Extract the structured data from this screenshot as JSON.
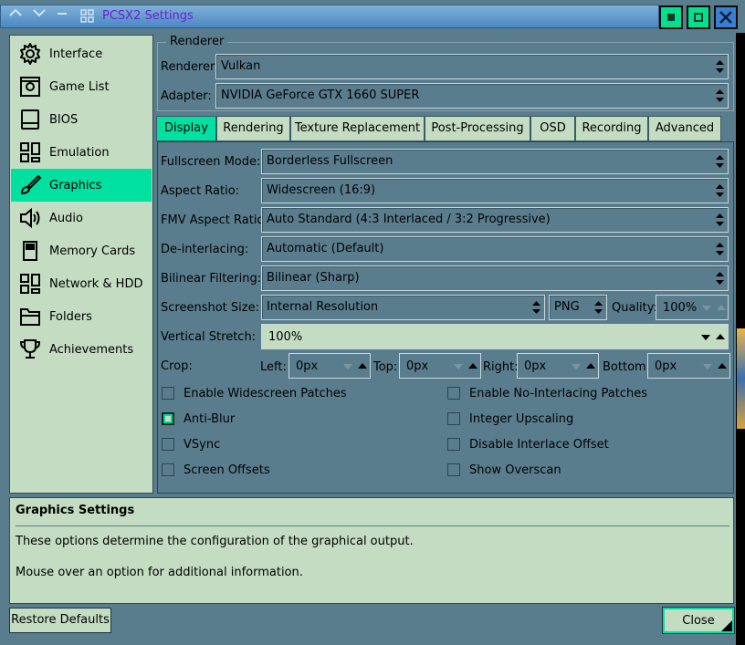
{
  "window": {
    "title": "PCSX2 Settings"
  },
  "sidebar": {
    "items": [
      {
        "label": "Interface",
        "icon": "gear-icon"
      },
      {
        "label": "Game List",
        "icon": "game-list-icon"
      },
      {
        "label": "BIOS",
        "icon": "bios-chip-icon"
      },
      {
        "label": "Emulation",
        "icon": "emulation-grid-icon"
      },
      {
        "label": "Graphics",
        "icon": "brush-icon",
        "selected": true
      },
      {
        "label": "Audio",
        "icon": "speaker-icon"
      },
      {
        "label": "Memory Cards",
        "icon": "memory-card-icon"
      },
      {
        "label": "Network & HDD",
        "icon": "network-icon"
      },
      {
        "label": "Folders",
        "icon": "folder-icon"
      },
      {
        "label": "Achievements",
        "icon": "trophy-icon"
      }
    ]
  },
  "renderer_group": {
    "title": "Renderer",
    "renderer_label": "Renderer:",
    "renderer_value": "Vulkan",
    "adapter_label": "Adapter:",
    "adapter_value": "NVIDIA GeForce GTX 1660 SUPER"
  },
  "tabs": [
    "Display",
    "Rendering",
    "Texture Replacement",
    "Post-Processing",
    "OSD",
    "Recording",
    "Advanced"
  ],
  "selected_tab": "Display",
  "display": {
    "fullscreen_label": "Fullscreen Mode:",
    "fullscreen_value": "Borderless Fullscreen",
    "aspect_label": "Aspect Ratio:",
    "aspect_value": "Widescreen (16:9)",
    "fmv_label": "FMV Aspect Ratio:",
    "fmv_value": "Auto Standard (4:3 Interlaced / 3:2 Progressive)",
    "deinterlace_label": "De-interlacing:",
    "deinterlace_value": "Automatic (Default)",
    "bilinear_label": "Bilinear Filtering:",
    "bilinear_value": "Bilinear (Sharp)",
    "screenshot_label": "Screenshot Size:",
    "screenshot_value": "Internal Resolution",
    "format_value": "PNG",
    "quality_label": "Quality:",
    "quality_value": "100%",
    "vstretch_label": "Vertical Stretch:",
    "vstretch_value": "100%",
    "crop_label": "Crop:",
    "crop_left_label": "Left:",
    "crop_left_value": "0px",
    "crop_top_label": "Top:",
    "crop_top_value": "0px",
    "crop_right_label": "Right:",
    "crop_right_value": "0px",
    "crop_bottom_label": "Bottom:",
    "crop_bottom_value": "0px"
  },
  "checkboxes": {
    "widescreen_patches": {
      "label": "Enable Widescreen Patches",
      "checked": false
    },
    "no_interlacing": {
      "label": "Enable No-Interlacing Patches",
      "checked": false
    },
    "anti_blur": {
      "label": "Anti-Blur",
      "checked": true
    },
    "integer_upscaling": {
      "label": "Integer Upscaling",
      "checked": false
    },
    "vsync": {
      "label": "VSync",
      "checked": false
    },
    "disable_interlace_offset": {
      "label": "Disable Interlace Offset",
      "checked": false
    },
    "screen_offsets": {
      "label": "Screen Offsets",
      "checked": false
    },
    "show_overscan": {
      "label": "Show Overscan",
      "checked": false
    }
  },
  "info": {
    "title": "Graphics Settings",
    "line1": "These options determine the configuration of the graphical output.",
    "line2": "Mouse over an option for additional information."
  },
  "buttons": {
    "restore": "Restore Defaults",
    "close": "Close"
  },
  "colors": {
    "accent": "#00e0a0",
    "panel": "#c3dcc2",
    "frame": "#5a7d8e",
    "title_text": "#6b1fd6"
  }
}
